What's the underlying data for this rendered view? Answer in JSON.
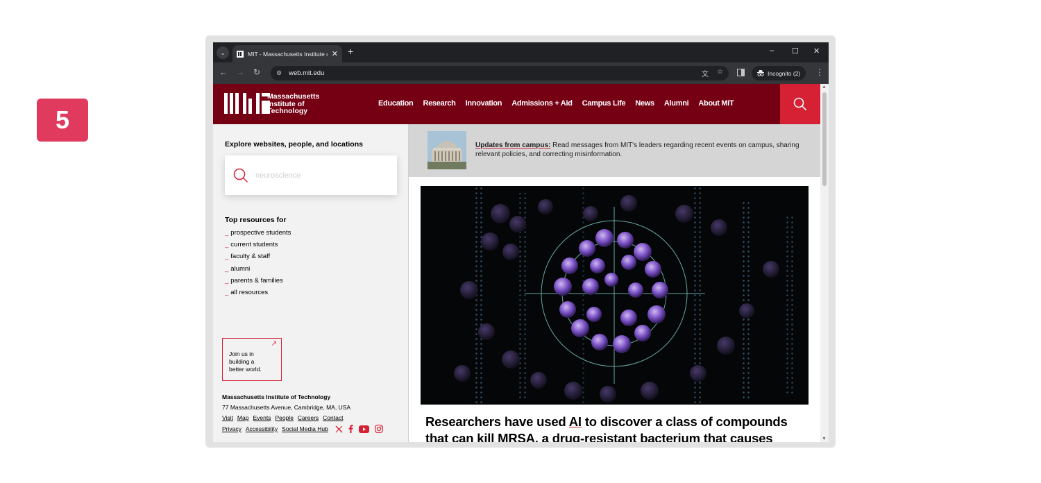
{
  "step_badge": "5",
  "browser": {
    "tab_title": "MIT - Massachusetts Institute of Technology",
    "tab_close": "✕",
    "new_tab": "+",
    "url": "web.mit.edu",
    "incognito_label": "Incognito (2)",
    "window_controls": {
      "minimize": "–",
      "maximize": "☐",
      "close": "✕"
    },
    "nav": {
      "back": "←",
      "forward": "→",
      "reload": "↻"
    }
  },
  "header": {
    "logo_line1": "Massachusetts",
    "logo_line2": "Institute of",
    "logo_line3": "Technology",
    "nav_items": [
      "Education",
      "Research",
      "Innovation",
      "Admissions + Aid",
      "Campus Life",
      "News",
      "Alumni",
      "About MIT"
    ]
  },
  "sidebar": {
    "explore_title": "Explore websites, people, and locations",
    "search_placeholder": "neuroscience",
    "top_resources_title": "Top resources for",
    "resources": [
      "prospective students",
      "current students",
      "faculty & staff",
      "alumni",
      "parents & families",
      "all resources"
    ],
    "join_text": [
      "Join us in",
      "building a",
      "better world."
    ],
    "footer_title": "Massachusetts Institute of Technology",
    "footer_address": "77 Massachusetts Avenue, Cambridge, MA, USA",
    "footer_links_row1": [
      "Visit",
      "Map",
      "Events",
      "People",
      "Careers",
      "Contact"
    ],
    "footer_links_row2": [
      "Privacy",
      "Accessibility",
      "Social Media Hub"
    ]
  },
  "main": {
    "updates_lead": "Updates from campus:",
    "updates_text": " Read messages from MIT's leaders regarding recent events on campus, sharing relevant policies, and correcting misinformation.",
    "headline_pre": "Researchers have used ",
    "headline_link": "AI",
    "headline_post": " to discover a class of compounds that can kill MRSA, a drug-resistant bacterium that causes"
  },
  "colors": {
    "mit_red": "#750014",
    "accent_red": "#d62134",
    "badge_pink": "#e03a5f"
  }
}
